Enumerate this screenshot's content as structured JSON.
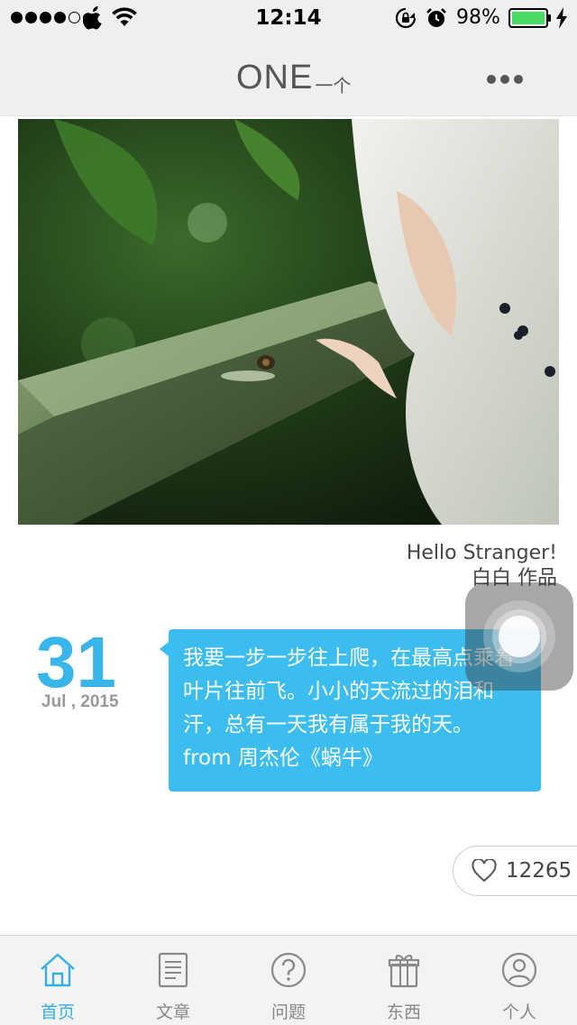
{
  "status_bar": {
    "time": "12:14",
    "battery": "98%",
    "signal_dots": 5,
    "signal_filled": 4
  },
  "navbar": {
    "logo_text": "ONE",
    "logo_sub": "一个",
    "more_icon": "more-dots-icon"
  },
  "photo": {
    "caption_title": "Hello Stranger!",
    "caption_author": "白白 作品"
  },
  "date": {
    "day": "31",
    "month_year": "Jul , 2015"
  },
  "quote": {
    "text": "我要一步一步往上爬，在最高点乘着叶片往前飞。小小的天流过的泪和汗，总有一天我有属于我的天。 from 周杰伦《蜗牛》"
  },
  "like": {
    "count": "12265"
  },
  "tabs": [
    {
      "label": "首页",
      "icon": "home-icon",
      "active": true
    },
    {
      "label": "文章",
      "icon": "article-icon",
      "active": false
    },
    {
      "label": "问题",
      "icon": "question-icon",
      "active": false
    },
    {
      "label": "东西",
      "icon": "gift-icon",
      "active": false
    },
    {
      "label": "个人",
      "icon": "person-icon",
      "active": false
    }
  ],
  "colors": {
    "accent": "#3ab5ea",
    "bubble": "#3cbdf0",
    "bar_bg": "#efefef"
  }
}
